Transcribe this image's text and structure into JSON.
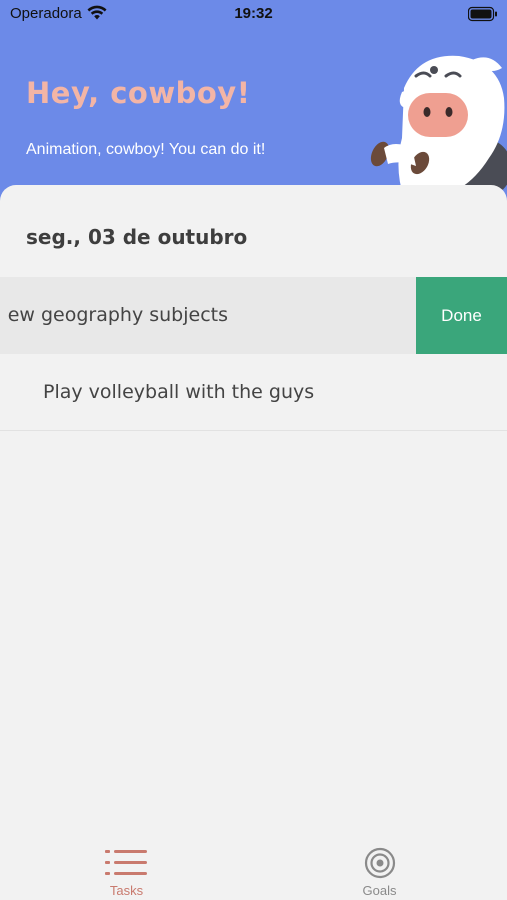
{
  "status_bar": {
    "carrier": "Operadora",
    "time": "19:32"
  },
  "header": {
    "greeting": "Hey, cowboy!",
    "subtitle": "Animation, cowboy! You can do it!"
  },
  "day": {
    "date_heading": "seg., 03 de outubro"
  },
  "tasks": [
    {
      "label": "Review geography subjects",
      "visible_text": "ew geography subjects",
      "swiped": true,
      "action_label": "Done"
    },
    {
      "label": "Play volleyball with the guys",
      "swiped": false
    }
  ],
  "tab_bar": {
    "tabs": [
      {
        "label": "Tasks",
        "icon": "list-icon",
        "selected": true
      },
      {
        "label": "Goals",
        "icon": "target-icon",
        "selected": false
      }
    ]
  },
  "colors": {
    "header_bg": "#6c8ae8",
    "greeting": "#f3b5a6",
    "done_action": "#3aa67b",
    "tab_selected": "#c97a6e",
    "tab_unselected": "#8a8a8a"
  }
}
